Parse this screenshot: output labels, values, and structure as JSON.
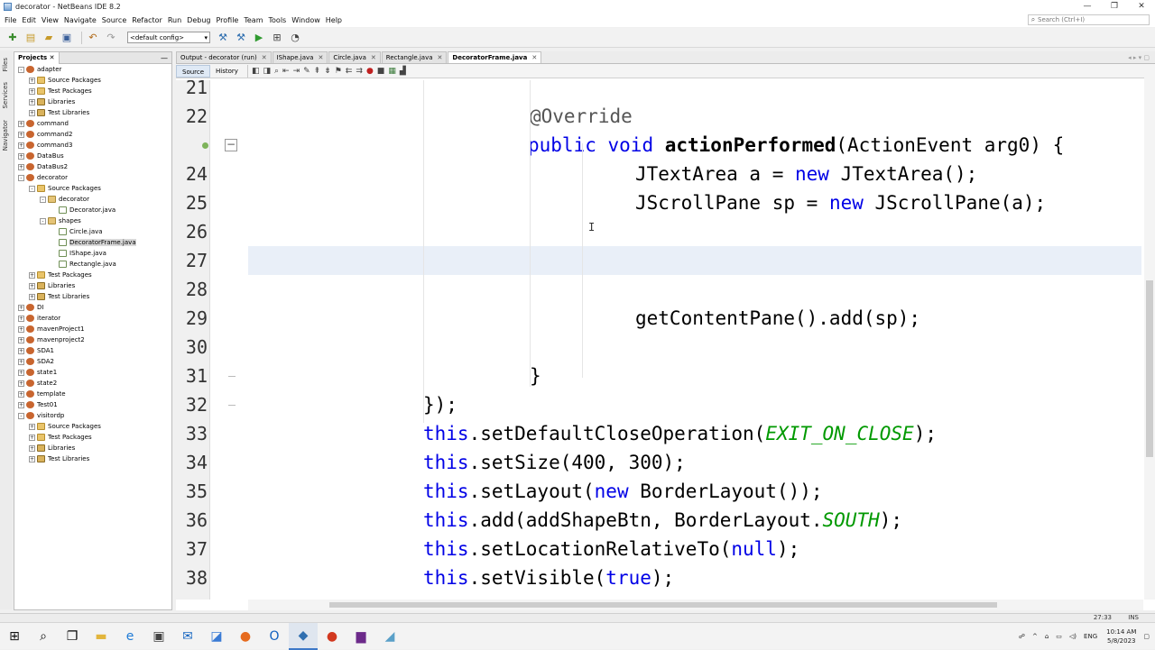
{
  "window": {
    "title": "decorator - NetBeans IDE 8.2",
    "controls": [
      "—",
      "❐",
      "✕"
    ]
  },
  "menu": [
    "File",
    "Edit",
    "View",
    "Navigate",
    "Source",
    "Refactor",
    "Run",
    "Debug",
    "Profile",
    "Team",
    "Tools",
    "Window",
    "Help"
  ],
  "search": {
    "placeholder": "Search (Ctrl+I)"
  },
  "toolbar": {
    "config_value": "<default config>"
  },
  "side_strip": [
    "Files",
    "Services",
    "Navigator"
  ],
  "projects_panel": {
    "tab_label": "Projects",
    "tree": [
      {
        "label": "adapter",
        "kind": "project",
        "depth": 0,
        "expander": "-"
      },
      {
        "label": "Source Packages",
        "kind": "folder",
        "depth": 1,
        "expander": "+"
      },
      {
        "label": "Test Packages",
        "kind": "folder",
        "depth": 1,
        "expander": "+"
      },
      {
        "label": "Libraries",
        "kind": "lib",
        "depth": 1,
        "expander": "+"
      },
      {
        "label": "Test Libraries",
        "kind": "lib",
        "depth": 1,
        "expander": "+"
      },
      {
        "label": "command",
        "kind": "project",
        "depth": 0,
        "expander": "+"
      },
      {
        "label": "command2",
        "kind": "project",
        "depth": 0,
        "expander": "+"
      },
      {
        "label": "command3",
        "kind": "project",
        "depth": 0,
        "expander": "+"
      },
      {
        "label": "DataBus",
        "kind": "project",
        "depth": 0,
        "expander": "+"
      },
      {
        "label": "DataBus2",
        "kind": "project",
        "depth": 0,
        "expander": "+"
      },
      {
        "label": "decorator",
        "kind": "project",
        "depth": 0,
        "expander": "-"
      },
      {
        "label": "Source Packages",
        "kind": "folder",
        "depth": 1,
        "expander": "-"
      },
      {
        "label": "decorator",
        "kind": "package",
        "depth": 2,
        "expander": "-"
      },
      {
        "label": "Decorator.java",
        "kind": "javafile",
        "depth": 3,
        "expander": ""
      },
      {
        "label": "shapes",
        "kind": "package",
        "depth": 2,
        "expander": "-"
      },
      {
        "label": "Circle.java",
        "kind": "javafile",
        "depth": 3,
        "expander": ""
      },
      {
        "label": "DecoratorFrame.java",
        "kind": "javafile",
        "depth": 3,
        "expander": "",
        "selected": true
      },
      {
        "label": "IShape.java",
        "kind": "javafile",
        "depth": 3,
        "expander": ""
      },
      {
        "label": "Rectangle.java",
        "kind": "javafile",
        "depth": 3,
        "expander": ""
      },
      {
        "label": "Test Packages",
        "kind": "folder",
        "depth": 1,
        "expander": "+"
      },
      {
        "label": "Libraries",
        "kind": "lib",
        "depth": 1,
        "expander": "+"
      },
      {
        "label": "Test Libraries",
        "kind": "lib",
        "depth": 1,
        "expander": "+"
      },
      {
        "label": "DI",
        "kind": "project",
        "depth": 0,
        "expander": "+"
      },
      {
        "label": "iterator",
        "kind": "project",
        "depth": 0,
        "expander": "+"
      },
      {
        "label": "mavenProject1",
        "kind": "project",
        "depth": 0,
        "expander": "+"
      },
      {
        "label": "mavenproject2",
        "kind": "project",
        "depth": 0,
        "expander": "+"
      },
      {
        "label": "SDA1",
        "kind": "project",
        "depth": 0,
        "expander": "+"
      },
      {
        "label": "SDA2",
        "kind": "project",
        "depth": 0,
        "expander": "+"
      },
      {
        "label": "state1",
        "kind": "project",
        "depth": 0,
        "expander": "+"
      },
      {
        "label": "state2",
        "kind": "project",
        "depth": 0,
        "expander": "+"
      },
      {
        "label": "template",
        "kind": "project",
        "depth": 0,
        "expander": "+"
      },
      {
        "label": "Test01",
        "kind": "project",
        "depth": 0,
        "expander": "+"
      },
      {
        "label": "visitordp",
        "kind": "project",
        "depth": 0,
        "expander": "-"
      },
      {
        "label": "Source Packages",
        "kind": "folder",
        "depth": 1,
        "expander": "+"
      },
      {
        "label": "Test Packages",
        "kind": "folder",
        "depth": 1,
        "expander": "+"
      },
      {
        "label": "Libraries",
        "kind": "lib",
        "depth": 1,
        "expander": "+"
      },
      {
        "label": "Test Libraries",
        "kind": "lib",
        "depth": 1,
        "expander": "+"
      }
    ]
  },
  "file_tabs": [
    {
      "label": "Output - decorator (run)",
      "active": false
    },
    {
      "label": "IShape.java",
      "active": false
    },
    {
      "label": "Circle.java",
      "active": false
    },
    {
      "label": "Rectangle.java",
      "active": false
    },
    {
      "label": "DecoratorFrame.java",
      "active": true
    }
  ],
  "editor_modes": [
    "Source",
    "History"
  ],
  "code_lines": [
    {
      "n": "21",
      "parts": []
    },
    {
      "n": "22",
      "parts": [
        {
          "t": "@Override",
          "c": "ann"
        }
      ]
    },
    {
      "n": "",
      "parts": [
        {
          "t": "public ",
          "c": "kw"
        },
        {
          "t": "void ",
          "c": "kw"
        },
        {
          "t": "actionPerformed",
          "c": "bold"
        },
        {
          "t": "(ActionEvent arg0) {",
          "c": ""
        }
      ]
    },
    {
      "n": "24",
      "parts": [
        {
          "t": "JTextArea a = ",
          "c": ""
        },
        {
          "t": "new ",
          "c": "kw"
        },
        {
          "t": "JTextArea();",
          "c": ""
        }
      ]
    },
    {
      "n": "25",
      "parts": [
        {
          "t": "JScrollPane sp = ",
          "c": ""
        },
        {
          "t": "new ",
          "c": "kw"
        },
        {
          "t": "JScrollPane(a);",
          "c": ""
        }
      ]
    },
    {
      "n": "26",
      "parts": []
    },
    {
      "n": "27",
      "parts": []
    },
    {
      "n": "28",
      "parts": []
    },
    {
      "n": "29",
      "parts": [
        {
          "t": "getContentPane().add(sp);",
          "c": ""
        }
      ]
    },
    {
      "n": "30",
      "parts": []
    },
    {
      "n": "31",
      "parts": [
        {
          "t": "}",
          "c": ""
        }
      ]
    },
    {
      "n": "32",
      "parts": [
        {
          "t": "});",
          "c": ""
        }
      ]
    },
    {
      "n": "33",
      "parts": [
        {
          "t": "this",
          "c": "kw"
        },
        {
          "t": ".setDefaultCloseOperation(",
          "c": ""
        },
        {
          "t": "EXIT_ON_CLOSE",
          "c": "const"
        },
        {
          "t": ");",
          "c": ""
        }
      ]
    },
    {
      "n": "34",
      "parts": [
        {
          "t": "this",
          "c": "kw"
        },
        {
          "t": ".setSize(400, 300);",
          "c": ""
        }
      ]
    },
    {
      "n": "35",
      "parts": [
        {
          "t": "this",
          "c": "kw"
        },
        {
          "t": ".setLayout(",
          "c": ""
        },
        {
          "t": "new ",
          "c": "kw"
        },
        {
          "t": "BorderLayout());",
          "c": ""
        }
      ]
    },
    {
      "n": "36",
      "parts": [
        {
          "t": "this",
          "c": "kw"
        },
        {
          "t": ".add(addShapeBtn, BorderLayout.",
          "c": ""
        },
        {
          "t": "SOUTH",
          "c": "const"
        },
        {
          "t": ");",
          "c": ""
        }
      ]
    },
    {
      "n": "37",
      "parts": [
        {
          "t": "this",
          "c": "kw"
        },
        {
          "t": ".setLocationRelativeTo(",
          "c": ""
        },
        {
          "t": "null",
          "c": "kw"
        },
        {
          "t": ");",
          "c": ""
        }
      ]
    },
    {
      "n": "38",
      "parts": [
        {
          "t": "this",
          "c": "kw"
        },
        {
          "t": ".setVisible(",
          "c": ""
        },
        {
          "t": "true",
          "c": "kw"
        },
        {
          "t": ");",
          "c": ""
        }
      ]
    }
  ],
  "status": {
    "position": "27:33",
    "mode": "INS"
  },
  "taskbar": {
    "tray_lang": "ENG",
    "time": "10:14 AM",
    "date": "5/8/2023"
  }
}
